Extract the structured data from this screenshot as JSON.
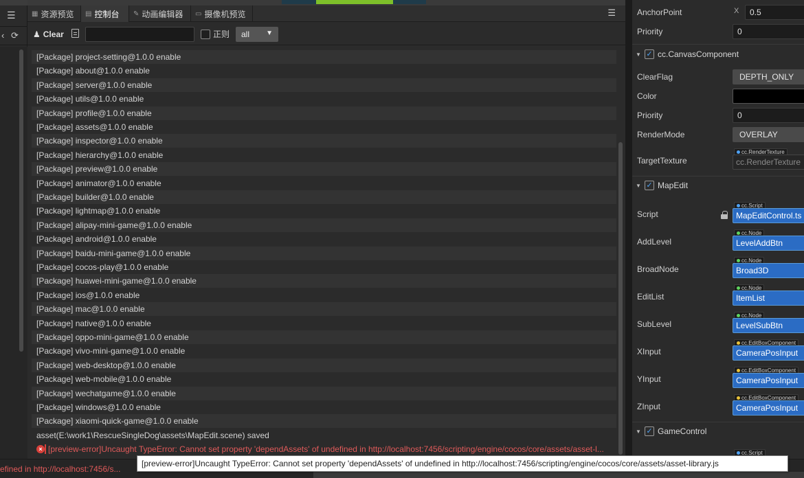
{
  "tabs": [
    {
      "label": "资源预览",
      "icon": "grid-icon",
      "active": false
    },
    {
      "label": "控制台",
      "icon": "console-icon",
      "active": true
    },
    {
      "label": "动画编辑器",
      "icon": "animation-icon",
      "active": false
    },
    {
      "label": "摄像机预览",
      "icon": "camera-icon",
      "active": false
    }
  ],
  "toolbar": {
    "clear_label": "Clear",
    "search_value": "",
    "regex_label": "正则",
    "regex_checked": false,
    "level_selected": "all"
  },
  "logs": [
    "[Package] project-setting@1.0.0 enable",
    "[Package] about@1.0.0 enable",
    "[Package] server@1.0.0 enable",
    "[Package] utils@1.0.0 enable",
    "[Package] profile@1.0.0 enable",
    "[Package] assets@1.0.0 enable",
    "[Package] inspector@1.0.0 enable",
    "[Package] hierarchy@1.0.0 enable",
    "[Package] preview@1.0.0 enable",
    "[Package] animator@1.0.0 enable",
    "[Package] builder@1.0.0 enable",
    "[Package] lightmap@1.0.0 enable",
    "[Package] alipay-mini-game@1.0.0 enable",
    "[Package] android@1.0.0 enable",
    "[Package] baidu-mini-game@1.0.0 enable",
    "[Package] cocos-play@1.0.0 enable",
    "[Package] huawei-mini-game@1.0.0 enable",
    "[Package] ios@1.0.0 enable",
    "[Package] mac@1.0.0 enable",
    "[Package] native@1.0.0 enable",
    "[Package] oppo-mini-game@1.0.0 enable",
    "[Package] vivo-mini-game@1.0.0 enable",
    "[Package] web-desktop@1.0.0 enable",
    "[Package] web-mobile@1.0.0 enable",
    "[Package] wechatgame@1.0.0 enable",
    "[Package] windows@1.0.0 enable",
    "[Package] xiaomi-quick-game@1.0.0 enable",
    "asset(E:\\work1\\RescueSingleDog\\assets\\MapEdit.scene) saved"
  ],
  "error_log": "[preview-error]Uncaught TypeError: Cannot set property 'dependAssets' of undefined in http://localhost:7456/scripting/engine/cocos/core/assets/asset-l...",
  "status_error": "efined in http://localhost:7456/s...",
  "tooltip": "[preview-error]Uncaught TypeError: Cannot set property 'dependAssets' of undefined in http://localhost:7456/scripting/engine/cocos/core/assets/asset-library.js",
  "inspector": {
    "anchor_label": "AnchorPoint",
    "anchor_axis": "X",
    "anchor_x": "0.5",
    "priority_label": "Priority",
    "priority_value": "0",
    "canvas_component": {
      "name": "cc.CanvasComponent",
      "clear_flag_label": "ClearFlag",
      "clear_flag_value": "DEPTH_ONLY",
      "color_label": "Color",
      "color_value": "#000000",
      "priority_label": "Priority",
      "priority_value": "0",
      "render_mode_label": "RenderMode",
      "render_mode_value": "OVERLAY",
      "target_texture_label": "TargetTexture",
      "target_texture_type": "cc.RenderTexture",
      "target_texture_value": "cc.RenderTexture"
    },
    "mapedit": {
      "name": "MapEdit",
      "props": [
        {
          "label": "Script",
          "type": "cc.Script",
          "value": "MapEditControl.ts",
          "locked": true,
          "dot": "#4ea1f3"
        },
        {
          "label": "AddLevel",
          "type": "cc.Node",
          "value": "LevelAddBtn",
          "dot": "#5fd35f"
        },
        {
          "label": "BroadNode",
          "type": "cc.Node",
          "value": "Broad3D",
          "dot": "#5fd35f"
        },
        {
          "label": "EditList",
          "type": "cc.Node",
          "value": "ItemList",
          "dot": "#5fd35f"
        },
        {
          "label": "SubLevel",
          "type": "cc.Node",
          "value": "LevelSubBtn",
          "dot": "#5fd35f"
        },
        {
          "label": "XInput",
          "type": "cc.EditBoxComponent",
          "value": "CameraPosInput",
          "dot": "#e8c23a"
        },
        {
          "label": "YInput",
          "type": "cc.EditBoxComponent",
          "value": "CameraPosInput",
          "dot": "#e8c23a"
        },
        {
          "label": "ZInput",
          "type": "cc.EditBoxComponent",
          "value": "CameraPosInput",
          "dot": "#e8c23a"
        }
      ]
    },
    "gamecontrol": {
      "name": "GameControl",
      "type": "cc.Script"
    }
  }
}
